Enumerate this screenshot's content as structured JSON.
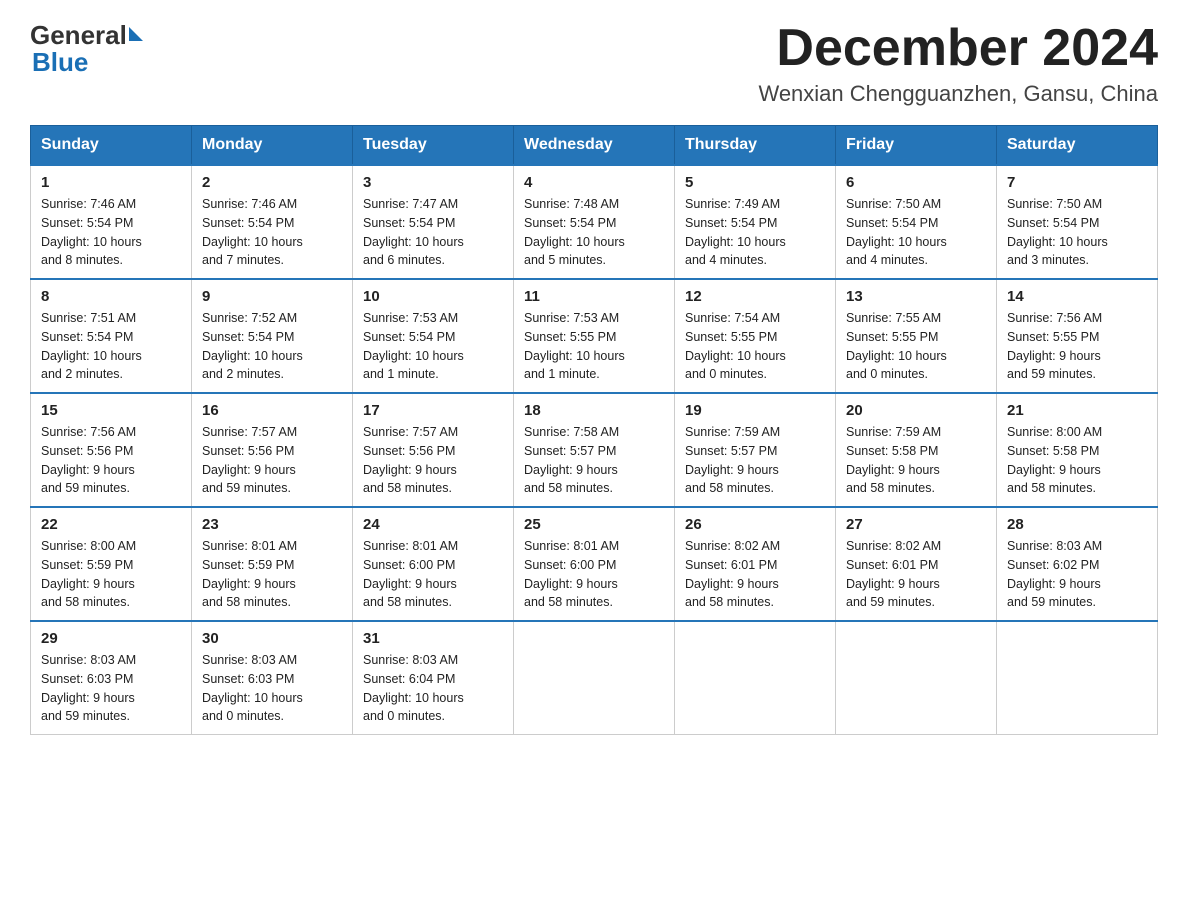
{
  "header": {
    "logo_general": "General",
    "logo_blue": "Blue",
    "month_title": "December 2024",
    "subtitle": "Wenxian Chengguanzhen, Gansu, China"
  },
  "weekdays": [
    "Sunday",
    "Monday",
    "Tuesday",
    "Wednesday",
    "Thursday",
    "Friday",
    "Saturday"
  ],
  "weeks": [
    [
      {
        "day": "1",
        "info": "Sunrise: 7:46 AM\nSunset: 5:54 PM\nDaylight: 10 hours\nand 8 minutes."
      },
      {
        "day": "2",
        "info": "Sunrise: 7:46 AM\nSunset: 5:54 PM\nDaylight: 10 hours\nand 7 minutes."
      },
      {
        "day": "3",
        "info": "Sunrise: 7:47 AM\nSunset: 5:54 PM\nDaylight: 10 hours\nand 6 minutes."
      },
      {
        "day": "4",
        "info": "Sunrise: 7:48 AM\nSunset: 5:54 PM\nDaylight: 10 hours\nand 5 minutes."
      },
      {
        "day": "5",
        "info": "Sunrise: 7:49 AM\nSunset: 5:54 PM\nDaylight: 10 hours\nand 4 minutes."
      },
      {
        "day": "6",
        "info": "Sunrise: 7:50 AM\nSunset: 5:54 PM\nDaylight: 10 hours\nand 4 minutes."
      },
      {
        "day": "7",
        "info": "Sunrise: 7:50 AM\nSunset: 5:54 PM\nDaylight: 10 hours\nand 3 minutes."
      }
    ],
    [
      {
        "day": "8",
        "info": "Sunrise: 7:51 AM\nSunset: 5:54 PM\nDaylight: 10 hours\nand 2 minutes."
      },
      {
        "day": "9",
        "info": "Sunrise: 7:52 AM\nSunset: 5:54 PM\nDaylight: 10 hours\nand 2 minutes."
      },
      {
        "day": "10",
        "info": "Sunrise: 7:53 AM\nSunset: 5:54 PM\nDaylight: 10 hours\nand 1 minute."
      },
      {
        "day": "11",
        "info": "Sunrise: 7:53 AM\nSunset: 5:55 PM\nDaylight: 10 hours\nand 1 minute."
      },
      {
        "day": "12",
        "info": "Sunrise: 7:54 AM\nSunset: 5:55 PM\nDaylight: 10 hours\nand 0 minutes."
      },
      {
        "day": "13",
        "info": "Sunrise: 7:55 AM\nSunset: 5:55 PM\nDaylight: 10 hours\nand 0 minutes."
      },
      {
        "day": "14",
        "info": "Sunrise: 7:56 AM\nSunset: 5:55 PM\nDaylight: 9 hours\nand 59 minutes."
      }
    ],
    [
      {
        "day": "15",
        "info": "Sunrise: 7:56 AM\nSunset: 5:56 PM\nDaylight: 9 hours\nand 59 minutes."
      },
      {
        "day": "16",
        "info": "Sunrise: 7:57 AM\nSunset: 5:56 PM\nDaylight: 9 hours\nand 59 minutes."
      },
      {
        "day": "17",
        "info": "Sunrise: 7:57 AM\nSunset: 5:56 PM\nDaylight: 9 hours\nand 58 minutes."
      },
      {
        "day": "18",
        "info": "Sunrise: 7:58 AM\nSunset: 5:57 PM\nDaylight: 9 hours\nand 58 minutes."
      },
      {
        "day": "19",
        "info": "Sunrise: 7:59 AM\nSunset: 5:57 PM\nDaylight: 9 hours\nand 58 minutes."
      },
      {
        "day": "20",
        "info": "Sunrise: 7:59 AM\nSunset: 5:58 PM\nDaylight: 9 hours\nand 58 minutes."
      },
      {
        "day": "21",
        "info": "Sunrise: 8:00 AM\nSunset: 5:58 PM\nDaylight: 9 hours\nand 58 minutes."
      }
    ],
    [
      {
        "day": "22",
        "info": "Sunrise: 8:00 AM\nSunset: 5:59 PM\nDaylight: 9 hours\nand 58 minutes."
      },
      {
        "day": "23",
        "info": "Sunrise: 8:01 AM\nSunset: 5:59 PM\nDaylight: 9 hours\nand 58 minutes."
      },
      {
        "day": "24",
        "info": "Sunrise: 8:01 AM\nSunset: 6:00 PM\nDaylight: 9 hours\nand 58 minutes."
      },
      {
        "day": "25",
        "info": "Sunrise: 8:01 AM\nSunset: 6:00 PM\nDaylight: 9 hours\nand 58 minutes."
      },
      {
        "day": "26",
        "info": "Sunrise: 8:02 AM\nSunset: 6:01 PM\nDaylight: 9 hours\nand 58 minutes."
      },
      {
        "day": "27",
        "info": "Sunrise: 8:02 AM\nSunset: 6:01 PM\nDaylight: 9 hours\nand 59 minutes."
      },
      {
        "day": "28",
        "info": "Sunrise: 8:03 AM\nSunset: 6:02 PM\nDaylight: 9 hours\nand 59 minutes."
      }
    ],
    [
      {
        "day": "29",
        "info": "Sunrise: 8:03 AM\nSunset: 6:03 PM\nDaylight: 9 hours\nand 59 minutes."
      },
      {
        "day": "30",
        "info": "Sunrise: 8:03 AM\nSunset: 6:03 PM\nDaylight: 10 hours\nand 0 minutes."
      },
      {
        "day": "31",
        "info": "Sunrise: 8:03 AM\nSunset: 6:04 PM\nDaylight: 10 hours\nand 0 minutes."
      },
      {
        "day": "",
        "info": ""
      },
      {
        "day": "",
        "info": ""
      },
      {
        "day": "",
        "info": ""
      },
      {
        "day": "",
        "info": ""
      }
    ]
  ]
}
